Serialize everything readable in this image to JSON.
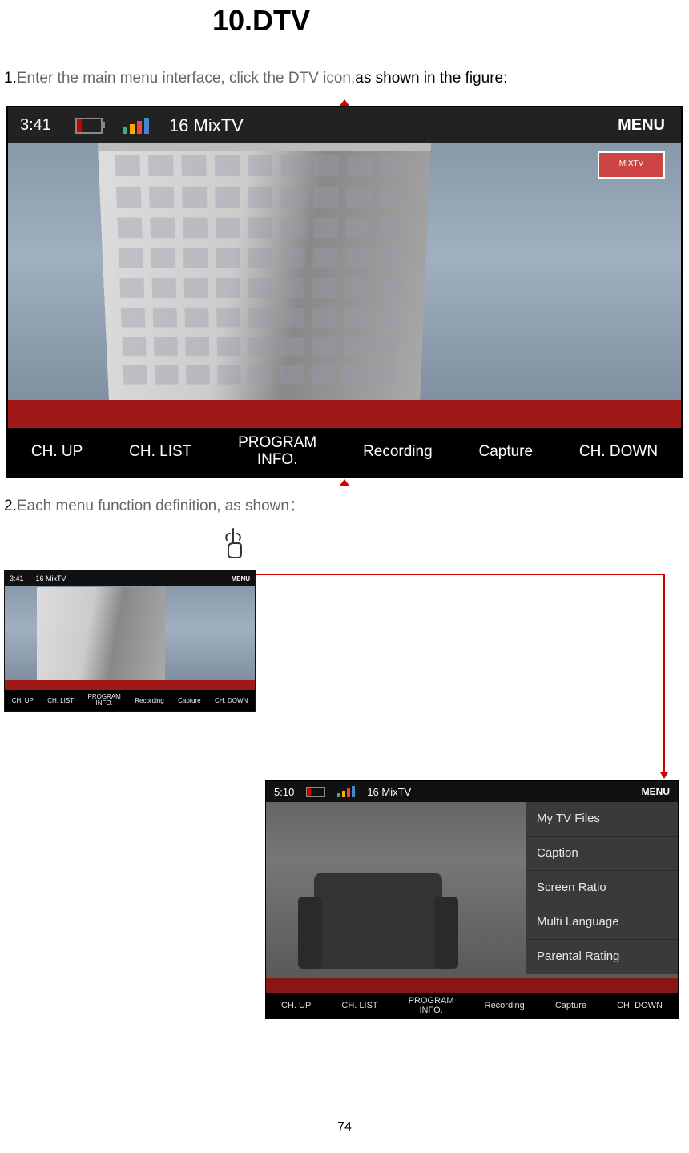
{
  "title": "10.DTV",
  "step1": {
    "num": "1.",
    "text_gray": "Enter the main menu interface, click the DTV icon,",
    "text_black": "as shown in the figure:"
  },
  "step2": {
    "num": "2.",
    "text": "Each menu function definition, as shown："
  },
  "screenshot1": {
    "time": "3:41",
    "channel": "16 MixTV",
    "menu": "MENU",
    "logo": "MIXTV",
    "bottom": {
      "ch_up": "CH. UP",
      "ch_list": "CH. LIST",
      "program_info_l1": "PROGRAM",
      "program_info_l2": "INFO.",
      "recording": "Recording",
      "capture": "Capture",
      "ch_down": "CH. DOWN"
    }
  },
  "thumb_small": {
    "time": "3:41",
    "channel": "16 MixTV",
    "menu": "MENU",
    "bottom": {
      "ch_up": "CH. UP",
      "ch_list": "CH. LIST",
      "program_info_l1": "PROGRAM",
      "program_info_l2": "INFO.",
      "recording": "Recording",
      "capture": "Capture",
      "ch_down": "CH. DOWN"
    }
  },
  "thumb_menu": {
    "time": "5:10",
    "channel": "16 MixTV",
    "menu": "MENU",
    "menu_items": {
      "i0": "My TV Files",
      "i1": "Caption",
      "i2": "Screen Ratio",
      "i3": "Multi Language",
      "i4": "Parental Rating"
    },
    "bottom": {
      "ch_up": "CH. UP",
      "ch_list": "CH. LIST",
      "program_info_l1": "PROGRAM",
      "program_info_l2": "INFO.",
      "recording": "Recording",
      "capture": "Capture",
      "ch_down": "CH. DOWN"
    }
  },
  "page_number": "74"
}
